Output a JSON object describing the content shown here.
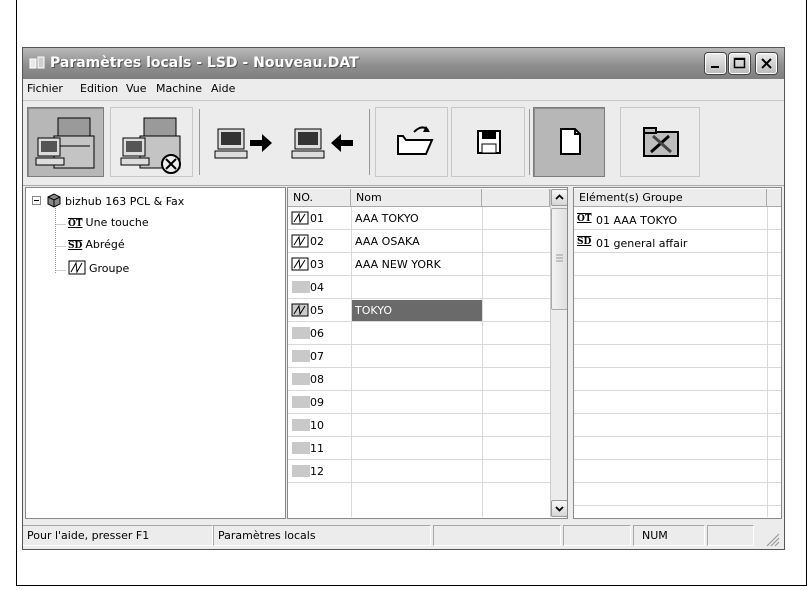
{
  "window": {
    "title": "Paramètres locals - LSD - Nouveau.DAT"
  },
  "menu": [
    "Fichier",
    "Edition",
    "Vue",
    "Machine",
    "Aide"
  ],
  "toolbar": {
    "buttons": [
      {
        "icon": "machine-local-icon",
        "state": "pressed"
      },
      {
        "icon": "machine-network-icon",
        "state": "raised"
      },
      {
        "icon": "send-to-machine-icon",
        "state": "flat"
      },
      {
        "icon": "receive-from-machine-icon",
        "state": "flat"
      },
      {
        "icon": "open-folder-icon",
        "state": "raised"
      },
      {
        "icon": "save-icon",
        "state": "raised"
      },
      {
        "icon": "new-document-icon",
        "state": "pressed"
      },
      {
        "icon": "tools-icon",
        "state": "raised"
      }
    ]
  },
  "tree": {
    "root_label": "bizhub 163 PCL & Fax",
    "children": [
      {
        "badge": "OT",
        "label": "Une touche"
      },
      {
        "badge": "SD",
        "label": "Abrégé"
      },
      {
        "badge": "",
        "label": "Groupe"
      }
    ]
  },
  "list": {
    "columns": [
      "NO.",
      "Nom"
    ],
    "rows": [
      {
        "no": "01",
        "nom": "AAA TOKYO",
        "group": true,
        "selected": false
      },
      {
        "no": "02",
        "nom": "AAA OSAKA",
        "group": true,
        "selected": false
      },
      {
        "no": "03",
        "nom": "AAA NEW YORK",
        "group": true,
        "selected": false
      },
      {
        "no": "04",
        "nom": "",
        "group": false,
        "selected": false
      },
      {
        "no": "05",
        "nom": "TOKYO",
        "group": true,
        "selected": true
      },
      {
        "no": "06",
        "nom": "",
        "group": false,
        "selected": false
      },
      {
        "no": "07",
        "nom": "",
        "group": false,
        "selected": false
      },
      {
        "no": "08",
        "nom": "",
        "group": false,
        "selected": false
      },
      {
        "no": "09",
        "nom": "",
        "group": false,
        "selected": false
      },
      {
        "no": "10",
        "nom": "",
        "group": false,
        "selected": false
      },
      {
        "no": "11",
        "nom": "",
        "group": false,
        "selected": false
      },
      {
        "no": "12",
        "nom": "",
        "group": false,
        "selected": false
      }
    ]
  },
  "group_panel": {
    "header": "Elément(s) Groupe",
    "items": [
      {
        "badge": "OT",
        "text": "01  AAA TOKYO"
      },
      {
        "badge": "SD",
        "text": "01  general affair"
      }
    ]
  },
  "statusbar": {
    "help": "Pour l'aide, presser F1",
    "mode": "Paramètres locals",
    "num": "NUM"
  }
}
